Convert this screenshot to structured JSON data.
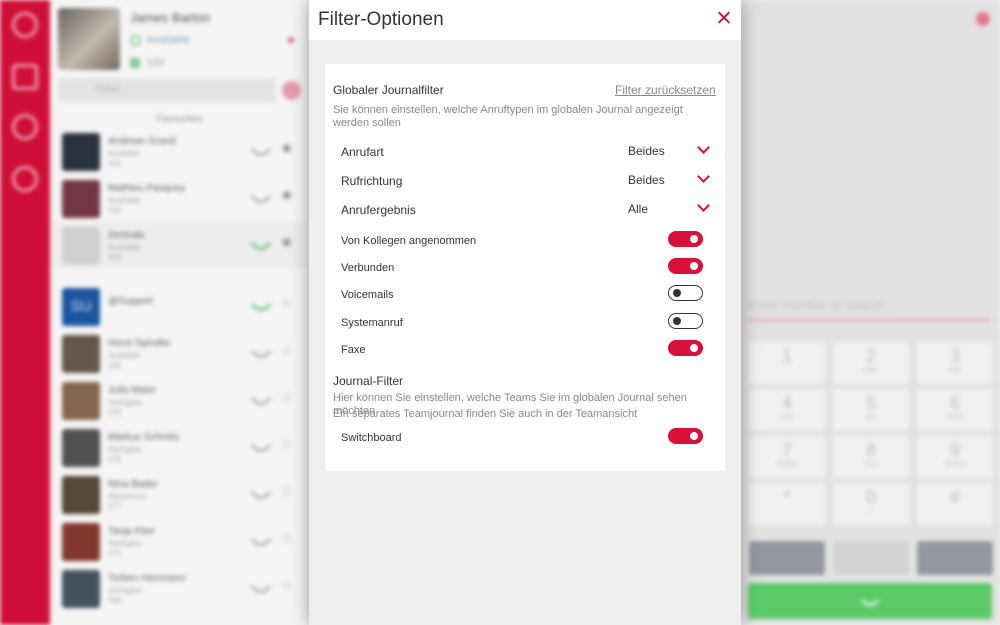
{
  "background": {
    "profile": {
      "name": "James Barton",
      "status": "Available",
      "extension": "100"
    },
    "filter_placeholder": "Filter...",
    "favourites_label": "Favourites",
    "contacts": [
      {
        "name": "Andreas Grand",
        "status": "Available",
        "ext": "101",
        "favourite": true
      },
      {
        "name": "Mathieu Pasquey",
        "status": "Available",
        "ext": "102",
        "favourite": true
      },
      {
        "name": "Zentrale",
        "status": "Available",
        "ext": "200",
        "favourite": true
      },
      {
        "name": "@Support",
        "status": "",
        "ext": "",
        "favourite": false
      },
      {
        "name": "Horst Spindler",
        "status": "Available",
        "ext": "103",
        "favourite": false
      },
      {
        "name": "Julia Maier",
        "status": "Verfügbar",
        "ext": "270",
        "favourite": false
      },
      {
        "name": "Markus Schmitz",
        "status": "Verfügbar",
        "ext": "276",
        "favourite": false
      },
      {
        "name": "Nina Bader",
        "status": "Abwesend",
        "ext": "277",
        "favourite": false
      },
      {
        "name": "Tanja Klee",
        "status": "Verfügbar",
        "ext": "271",
        "favourite": false
      },
      {
        "name": "Torben Herrmann",
        "status": "Verfügbar",
        "ext": "290",
        "favourite": false
      }
    ],
    "support_initials": "SU",
    "dial_placeholder": "Enter number or search...",
    "keys": [
      {
        "d": "1",
        "l": ""
      },
      {
        "d": "2",
        "l": "ABC"
      },
      {
        "d": "3",
        "l": "DEF"
      },
      {
        "d": "4",
        "l": "GHI"
      },
      {
        "d": "5",
        "l": "JKL"
      },
      {
        "d": "6",
        "l": "MNO"
      },
      {
        "d": "7",
        "l": "PQRS"
      },
      {
        "d": "8",
        "l": "TUV"
      },
      {
        "d": "9",
        "l": "WXYZ"
      },
      {
        "d": "*",
        "l": ""
      },
      {
        "d": "0",
        "l": "+"
      },
      {
        "d": "#",
        "l": ""
      }
    ]
  },
  "modal": {
    "title": "Filter-Optionen",
    "global": {
      "heading": "Globaler Journalfilter",
      "reset_label": "Filter zurücksetzen",
      "description": "Sie können einstellen, welche Anruftypen im globalen Journal angezeigt werden sollen",
      "selects": [
        {
          "label": "Anrufart",
          "value": "Beides"
        },
        {
          "label": "Rufrichtung",
          "value": "Beides"
        },
        {
          "label": "Anrufergebnis",
          "value": "Alle"
        }
      ],
      "toggles": [
        {
          "label": "Von Kollegen angenommen",
          "on": true
        },
        {
          "label": "Verbunden",
          "on": true
        },
        {
          "label": "Voicemails",
          "on": false
        },
        {
          "label": "Systemanruf",
          "on": false
        },
        {
          "label": "Faxe",
          "on": true
        }
      ]
    },
    "journal": {
      "heading": "Journal-Filter",
      "description_1": "Hier können Sie einstellen, welche Teams Sie im globalen Journal sehen möchten",
      "description_2": "Ein separates Teamjournal finden Sie auch in der Teamansicht",
      "toggles": [
        {
          "label": "Switchboard",
          "on": true
        }
      ]
    }
  },
  "colors": {
    "accent": "#d8103a",
    "call_green": "#5fd46c"
  }
}
